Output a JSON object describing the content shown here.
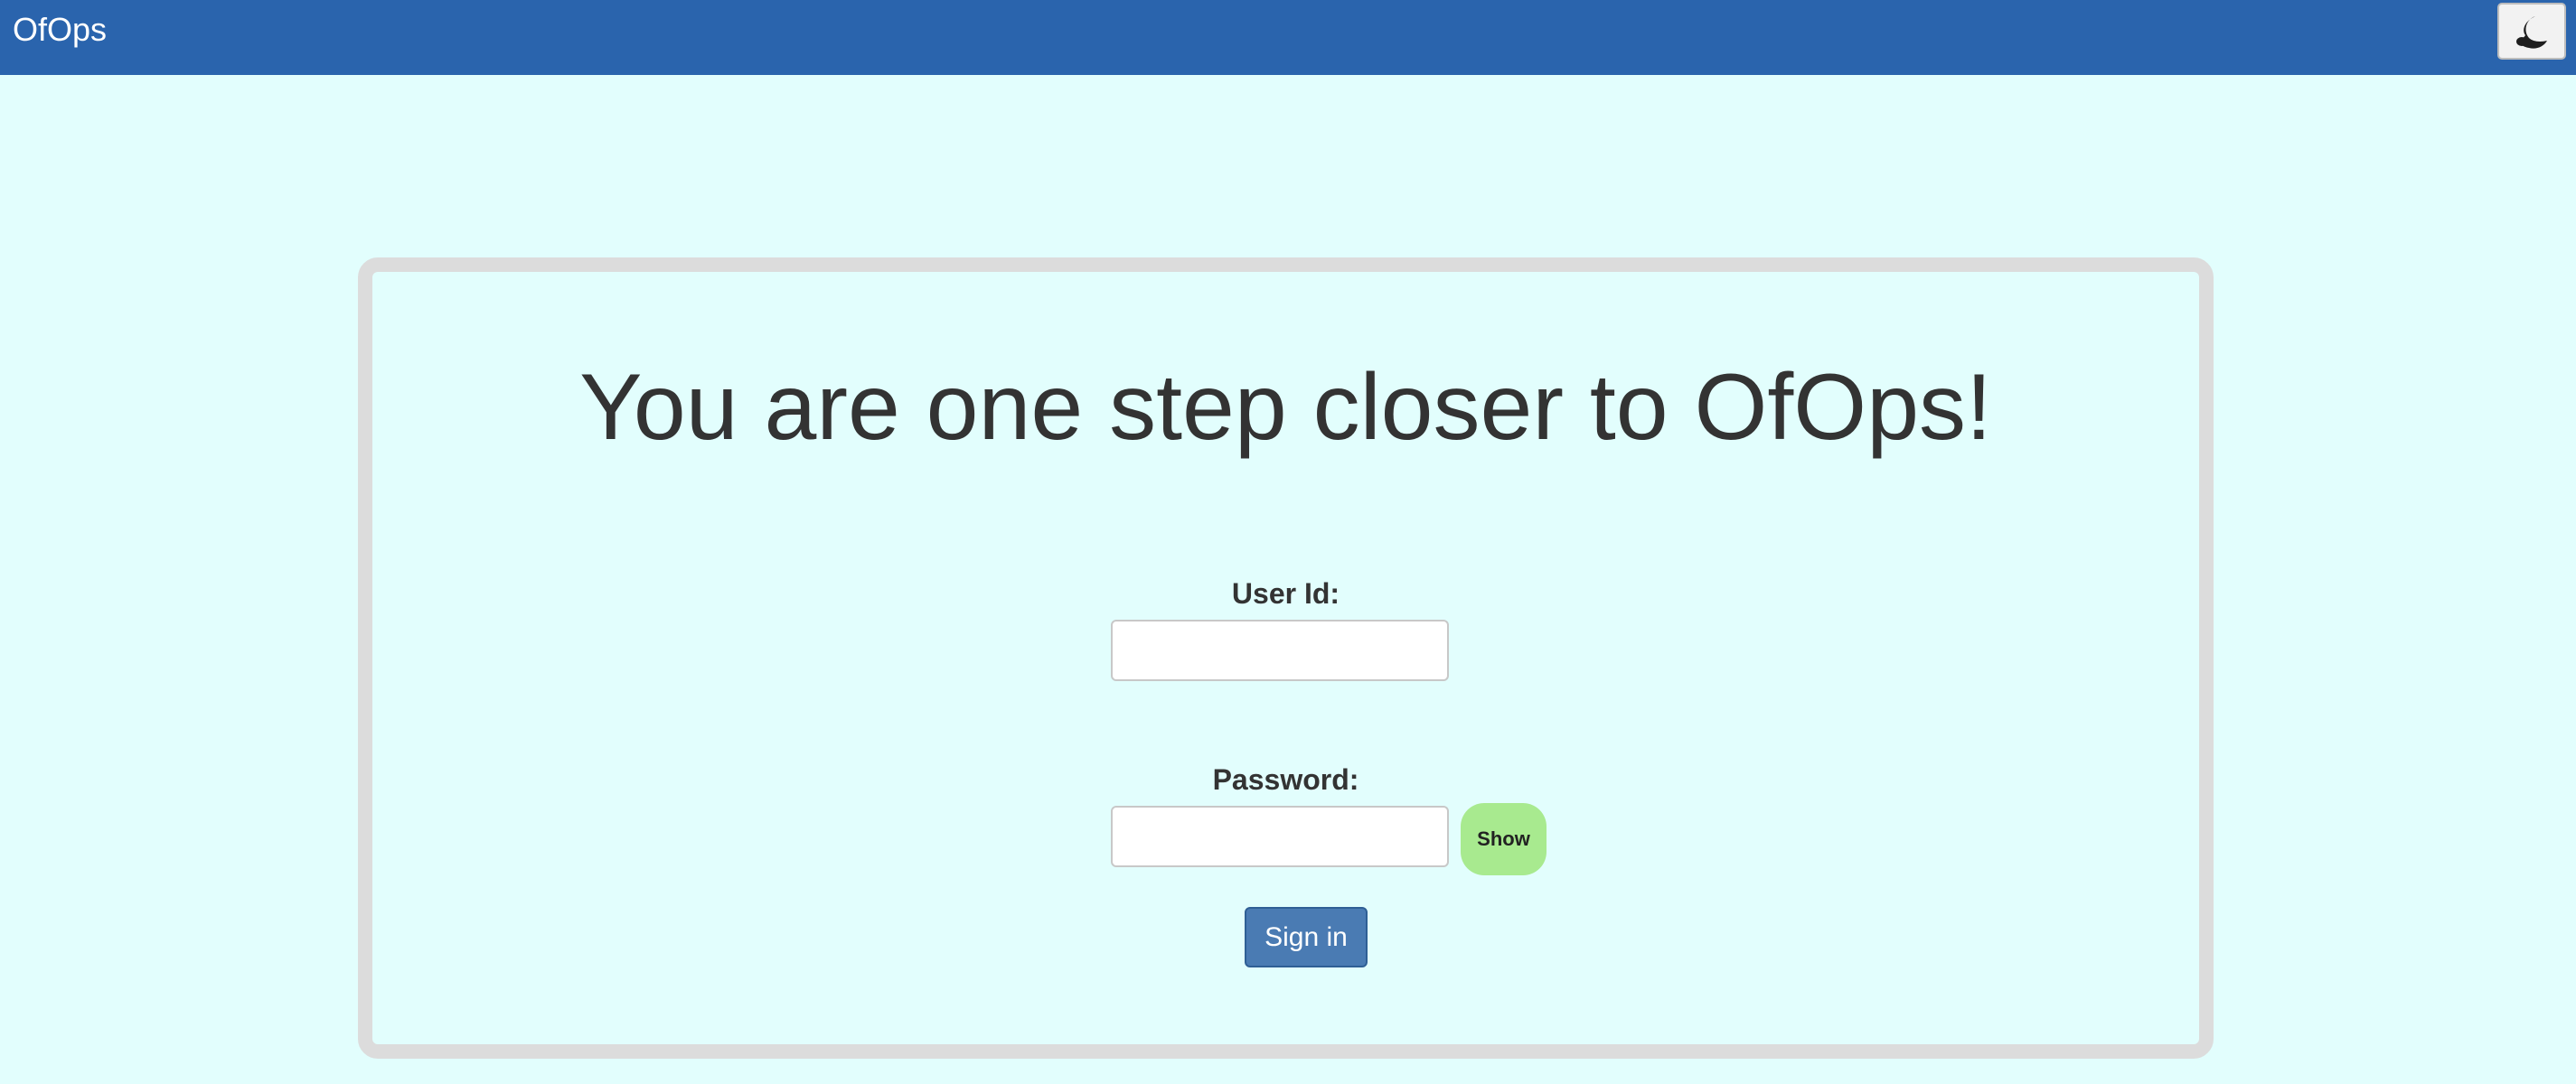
{
  "header": {
    "brand": "OfOps",
    "theme_toggle_icon": "moon-icon"
  },
  "login": {
    "headline": "You are one step closer to OfOps!",
    "user_id_label": "User Id:",
    "user_id_value": "",
    "password_label": "Password:",
    "password_value": "",
    "show_label": "Show",
    "sign_in_label": "Sign in"
  },
  "colors": {
    "header_bg": "#2a64ad",
    "page_bg": "#e2fefd",
    "card_border": "#dcdcdc",
    "show_button_bg": "#a8ea8f",
    "sign_in_button_bg": "#4a7bb3",
    "text": "#333333"
  }
}
